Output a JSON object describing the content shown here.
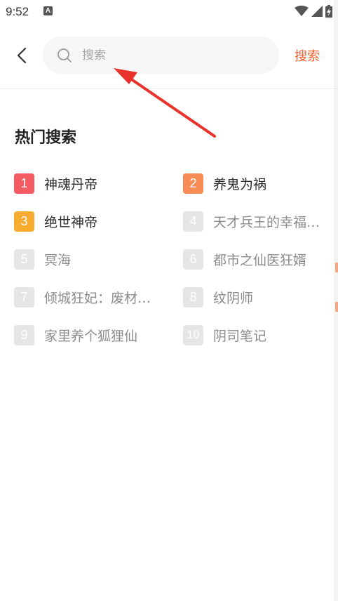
{
  "status_bar": {
    "time": "9:52",
    "notification_icon": "A"
  },
  "header": {
    "back_icon": "chevron-left-icon",
    "search": {
      "placeholder": "搜索",
      "value": ""
    },
    "search_button_label": "搜索",
    "accent_color": "#f05b2a"
  },
  "hot_search": {
    "title": "热门搜索",
    "items": [
      {
        "rank": "1",
        "name": "神魂丹帝"
      },
      {
        "rank": "2",
        "name": "养鬼为祸"
      },
      {
        "rank": "3",
        "name": "绝世神帝"
      },
      {
        "rank": "4",
        "name": "天才兵王的幸福…"
      },
      {
        "rank": "5",
        "name": "冥海"
      },
      {
        "rank": "6",
        "name": "都市之仙医狂婿"
      },
      {
        "rank": "7",
        "name": "倾城狂妃：废材…"
      },
      {
        "rank": "8",
        "name": "纹阴师"
      },
      {
        "rank": "9",
        "name": "家里养个狐狸仙"
      },
      {
        "rank": "10",
        "name": "阴司笔记"
      }
    ],
    "rank_colors": {
      "1": "#f45b62",
      "2": "#f78c57",
      "3": "#f8ac2f",
      "other": "#e6e6e6"
    }
  }
}
